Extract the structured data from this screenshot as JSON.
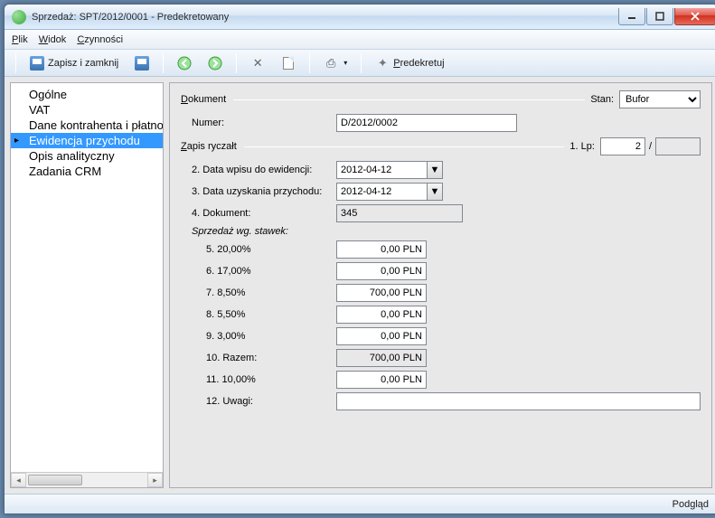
{
  "window": {
    "title": "Sprzedaż: SPT/2012/0001 - Predekretowany"
  },
  "menu": {
    "file": "Plik",
    "view": "Widok",
    "actions": "Czynności"
  },
  "toolbar": {
    "save_close": "Zapisz i zamknij",
    "predecree": "Predekretuj"
  },
  "sidebar": {
    "items": [
      {
        "label": "Ogólne"
      },
      {
        "label": "VAT"
      },
      {
        "label": "Dane kontrahenta i płatności"
      },
      {
        "label": "Ewidencja przychodu"
      },
      {
        "label": "Opis analityczny"
      },
      {
        "label": "Zadania CRM"
      }
    ]
  },
  "form": {
    "group_document": "Dokument",
    "state_label": "Stan:",
    "state_value": "Bufor",
    "number_label": "Numer:",
    "number_value": "D/2012/0002",
    "group_ryczalt": "Zapis ryczałt",
    "lp_label": "1. Lp:",
    "lp_value": "2",
    "lp_sep": "/",
    "lp2_value": "",
    "f2_label": "2. Data wpisu do ewidencji:",
    "f2_value": "2012-04-12",
    "f3_label": "3. Data uzyskania przychodu:",
    "f3_value": "2012-04-12",
    "f4_label": "4. Dokument:",
    "f4_value": "345",
    "rates_header": "Sprzedaż wg. stawek:",
    "r5_label": "5.  20,00%",
    "r5_value": "0,00 PLN",
    "r6_label": "6.  17,00%",
    "r6_value": "0,00 PLN",
    "r7_label": "7.  8,50%",
    "r7_value": "700,00 PLN",
    "r8_label": "8.  5,50%",
    "r8_value": "0,00 PLN",
    "r9_label": "9.  3,00%",
    "r9_value": "0,00 PLN",
    "r10_label": "10. Razem:",
    "r10_value": "700,00 PLN",
    "r11_label": "11. 10,00%",
    "r11_value": "0,00 PLN",
    "r12_label": "12. Uwagi:",
    "r12_value": ""
  },
  "status": {
    "preview": "Podgląd"
  }
}
